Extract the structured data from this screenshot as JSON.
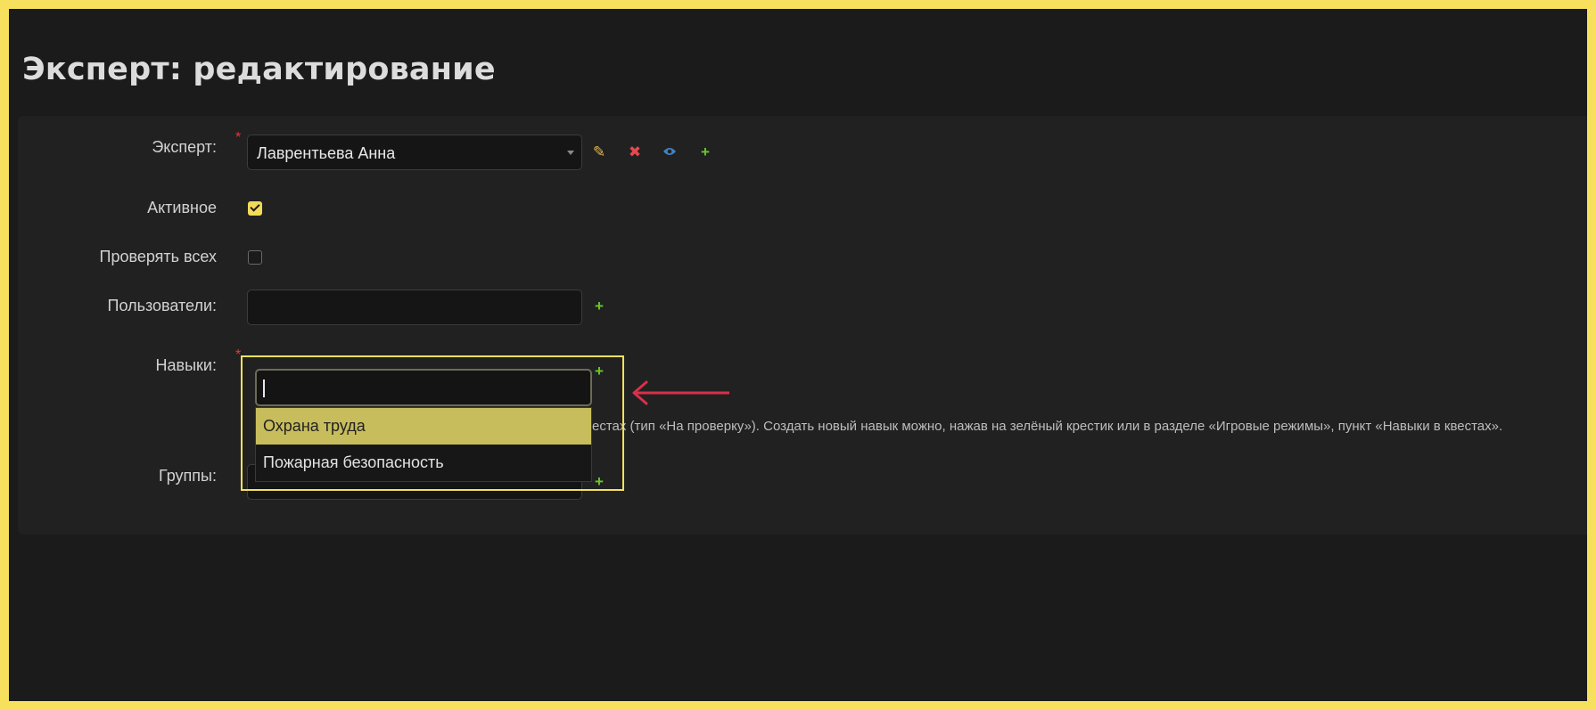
{
  "page": {
    "title": "Эксперт: редактирование"
  },
  "form": {
    "expert": {
      "label": "Эксперт:",
      "required_mark": "*",
      "value": "Лаврентьева Анна"
    },
    "active": {
      "label": "Активное",
      "checked": true
    },
    "check_all": {
      "label": "Проверять всех",
      "checked": false
    },
    "users": {
      "label": "Пользователи:"
    },
    "skills": {
      "label": "Навыки:",
      "required_mark": "*",
      "input_value": "",
      "options": [
        "Охрана труда",
        "Пожарная безопасность"
      ],
      "highlighted_option": "Охрана труда",
      "help_text_visible": "естах (тип «На проверку»). Создать новый навык можно, нажав на зелёный крестик или в разделе «Игровые режимы», пункт «Навыки в квестах»."
    },
    "groups": {
      "label": "Группы:"
    }
  },
  "icons": {
    "expert_actions": [
      "pencil-icon",
      "delete-icon",
      "eye-icon",
      "plus-icon"
    ],
    "add": "plus-icon"
  },
  "colors": {
    "accent_yellow": "#f3e15f",
    "required_red": "#e03a3a",
    "add_green": "#6cc72c",
    "edit_yellow": "#e8b93a",
    "delete_red": "#e5484d",
    "view_blue": "#3b82c6",
    "annotation_arrow": "#d8304a"
  }
}
